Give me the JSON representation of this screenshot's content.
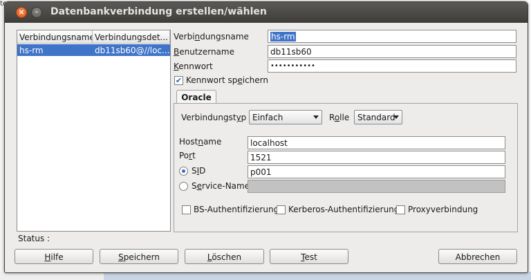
{
  "background": {
    "fragment": "te",
    "accent": "#c9d6e6"
  },
  "window": {
    "title": "Datenbankverbindung erstellen/wählen",
    "close_glyph": "×",
    "minimize_glyph": "–"
  },
  "connections": {
    "columns": [
      "Verbindungsname",
      "Verbindungsdet..."
    ],
    "rows": [
      {
        "name": "hs-rm",
        "details": "db11sb60@//loc..."
      }
    ]
  },
  "form": {
    "connection_name": {
      "label_pre": "Verbi",
      "label_key": "n",
      "label_post": "dungsname",
      "value": "hs-rm"
    },
    "username": {
      "label_pre": "",
      "label_key": "B",
      "label_post": "enutzername",
      "value": "db11sb60"
    },
    "password": {
      "label_pre": "",
      "label_key": "K",
      "label_post": "ennwort",
      "value": "•••••••••••"
    },
    "save_password": {
      "label_pre": "Kennwort sp",
      "label_key": "e",
      "label_post": "ichern",
      "checked": true
    }
  },
  "oracle": {
    "tab_label": "Oracle",
    "connection_type": {
      "label_pre": "Verbindungst",
      "label_key": "y",
      "label_post": "p",
      "value": "Einfach"
    },
    "role": {
      "label_pre": "R",
      "label_key": "o",
      "label_post": "lle",
      "value": "Standard"
    },
    "hostname": {
      "label_pre": "Host",
      "label_key": "n",
      "label_post": "ame",
      "value": "localhost"
    },
    "port": {
      "label_pre": "Po",
      "label_key": "r",
      "label_post": "t",
      "value": "1521"
    },
    "sid": {
      "label_pre": "S",
      "label_key": "I",
      "label_post": "D",
      "value": "p001",
      "selected": true
    },
    "service_name": {
      "label_pre": "S",
      "label_key": "e",
      "label_post": "rvice-Name",
      "value": "",
      "selected": false
    },
    "options": [
      {
        "label": "BS-Authentifizierung",
        "checked": false
      },
      {
        "label": "Kerberos-Authentifizierung",
        "checked": false
      },
      {
        "label": "Proxyverbindung",
        "checked": false
      }
    ]
  },
  "status": {
    "label": "Status :"
  },
  "buttons": {
    "help": {
      "key": "H",
      "rest": "ilfe"
    },
    "save": {
      "key": "S",
      "rest": "peichern"
    },
    "delete": {
      "key": "L",
      "rest": "öschen"
    },
    "test": {
      "key": "T",
      "rest": "est"
    },
    "cancel": {
      "label": "Abbrechen"
    }
  },
  "colors": {
    "selection": "#3f74c8",
    "close_button": "#e8641f",
    "titlebar": "#4a4945"
  }
}
